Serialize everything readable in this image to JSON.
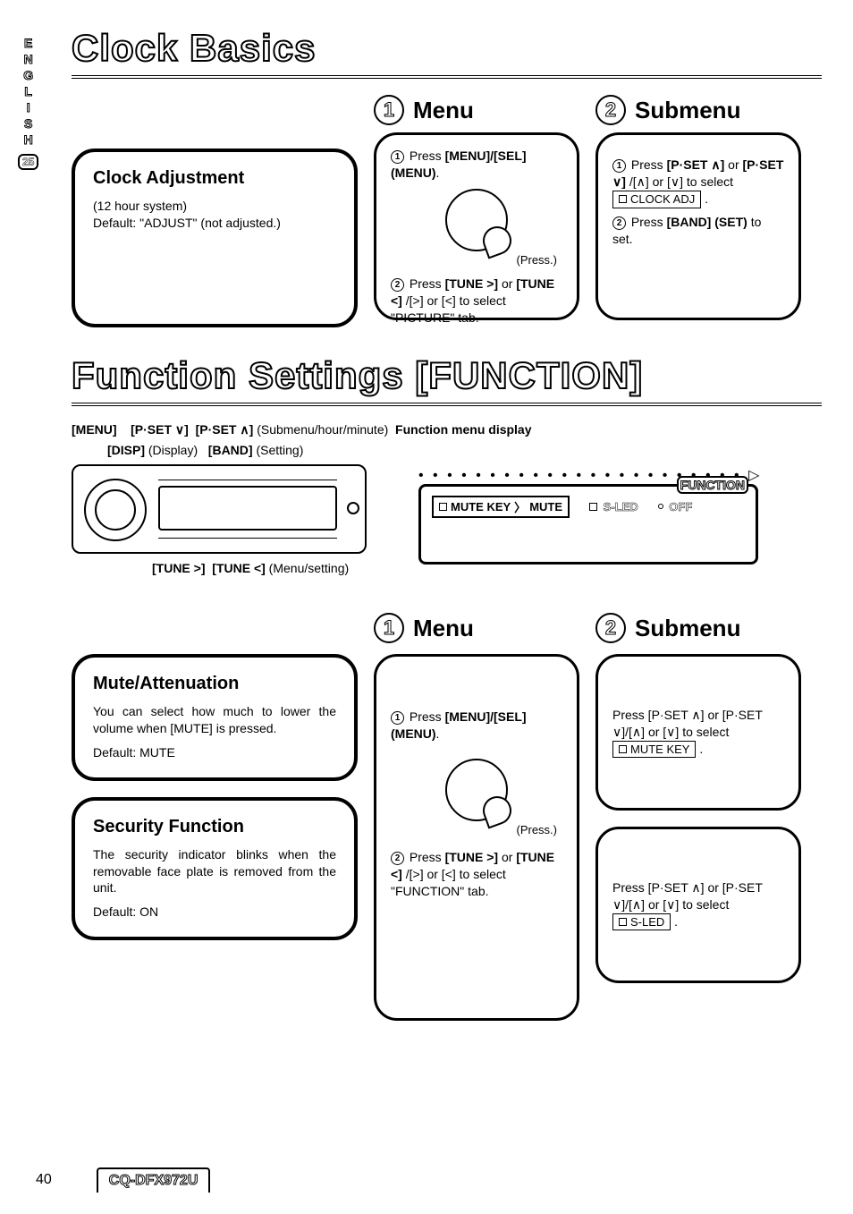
{
  "side": {
    "lang": "ENGLISH",
    "page_badge": "25"
  },
  "footer": {
    "pagenum": "40",
    "model": "CQ-DFX972U"
  },
  "section1": {
    "title": "Clock Basics",
    "step1_label": "Menu",
    "step2_label": "Submenu",
    "clock": {
      "title": "Clock Adjustment",
      "sub1": "(12 hour system)",
      "sub2": "Default: \"ADJUST\" (not adjusted.)"
    },
    "menu": {
      "line1a": "Press ",
      "line1b": "[MENU]/[SEL] (MENU)",
      "line1c": ".",
      "press": "(Press.)",
      "line2a": "Press ",
      "line2b": "[TUNE >]",
      "line2c": " or ",
      "line2d": "[TUNE <]",
      "line2e": "/[>] or [<] to select \"PICTURE\" tab."
    },
    "submenu": {
      "line1a": "Press ",
      "line1b": "[P·SET ∧]",
      "line1c": " or ",
      "line1d": "[P·SET ∨]",
      "line1e": "/[∧] or [∨] to select",
      "chip": "CLOCK ADJ",
      "line2a": "Press ",
      "line2b": "[BAND] (SET)",
      "line2c": " to set."
    }
  },
  "section2": {
    "title": "Function Settings [FUNCTION]",
    "toplabels": {
      "menu": "[MENU]",
      "pset_dn": "[P·SET ∨]",
      "pset_up": "[P·SET ∧]",
      "pset_note": "(Submenu/hour/minute)",
      "fmd": "Function menu display",
      "disp": "[DISP]",
      "disp_note": "(Display)",
      "band": "[BAND]",
      "band_note": "(Setting)",
      "tune_r": "[TUNE >]",
      "tune_l": "[TUNE <]",
      "tune_note": "(Menu/setting)"
    },
    "panel": {
      "corner": "FUNCTION",
      "chip1_a": "MUTE KEY",
      "chip1_b": "MUTE",
      "chip2": "S-LED",
      "chip2_val": "OFF"
    },
    "step1_label": "Menu",
    "step2_label": "Submenu",
    "mute": {
      "title": "Mute/Attenuation",
      "body": "You can select how much to lower the volume when [MUTE] is pressed.",
      "default": "Default: MUTE"
    },
    "security": {
      "title": "Security Function",
      "body": "The security indicator blinks when the removable face plate is removed from the unit.",
      "default": "Default: ON"
    },
    "menu": {
      "line1a": "Press ",
      "line1b": "[MENU]/[SEL] (MENU)",
      "line1c": ".",
      "press": "(Press.)",
      "line2a": "Press ",
      "line2b": "[TUNE >]",
      "line2c": " or ",
      "line2d": "[TUNE <]",
      "line2e": "/[>] or [<] to select \"FUNCTION\" tab."
    },
    "submenu_mute": {
      "line1": "Press [P·SET ∧] or [P·SET ∨]/[∧] or [∨] to select",
      "chip": "MUTE KEY"
    },
    "submenu_sled": {
      "line1": "Press [P·SET ∧] or [P·SET ∨]/[∧] or [∨] to select ",
      "chip": "S-LED"
    }
  },
  "glyphs": {
    "one": "1",
    "two": "2"
  }
}
